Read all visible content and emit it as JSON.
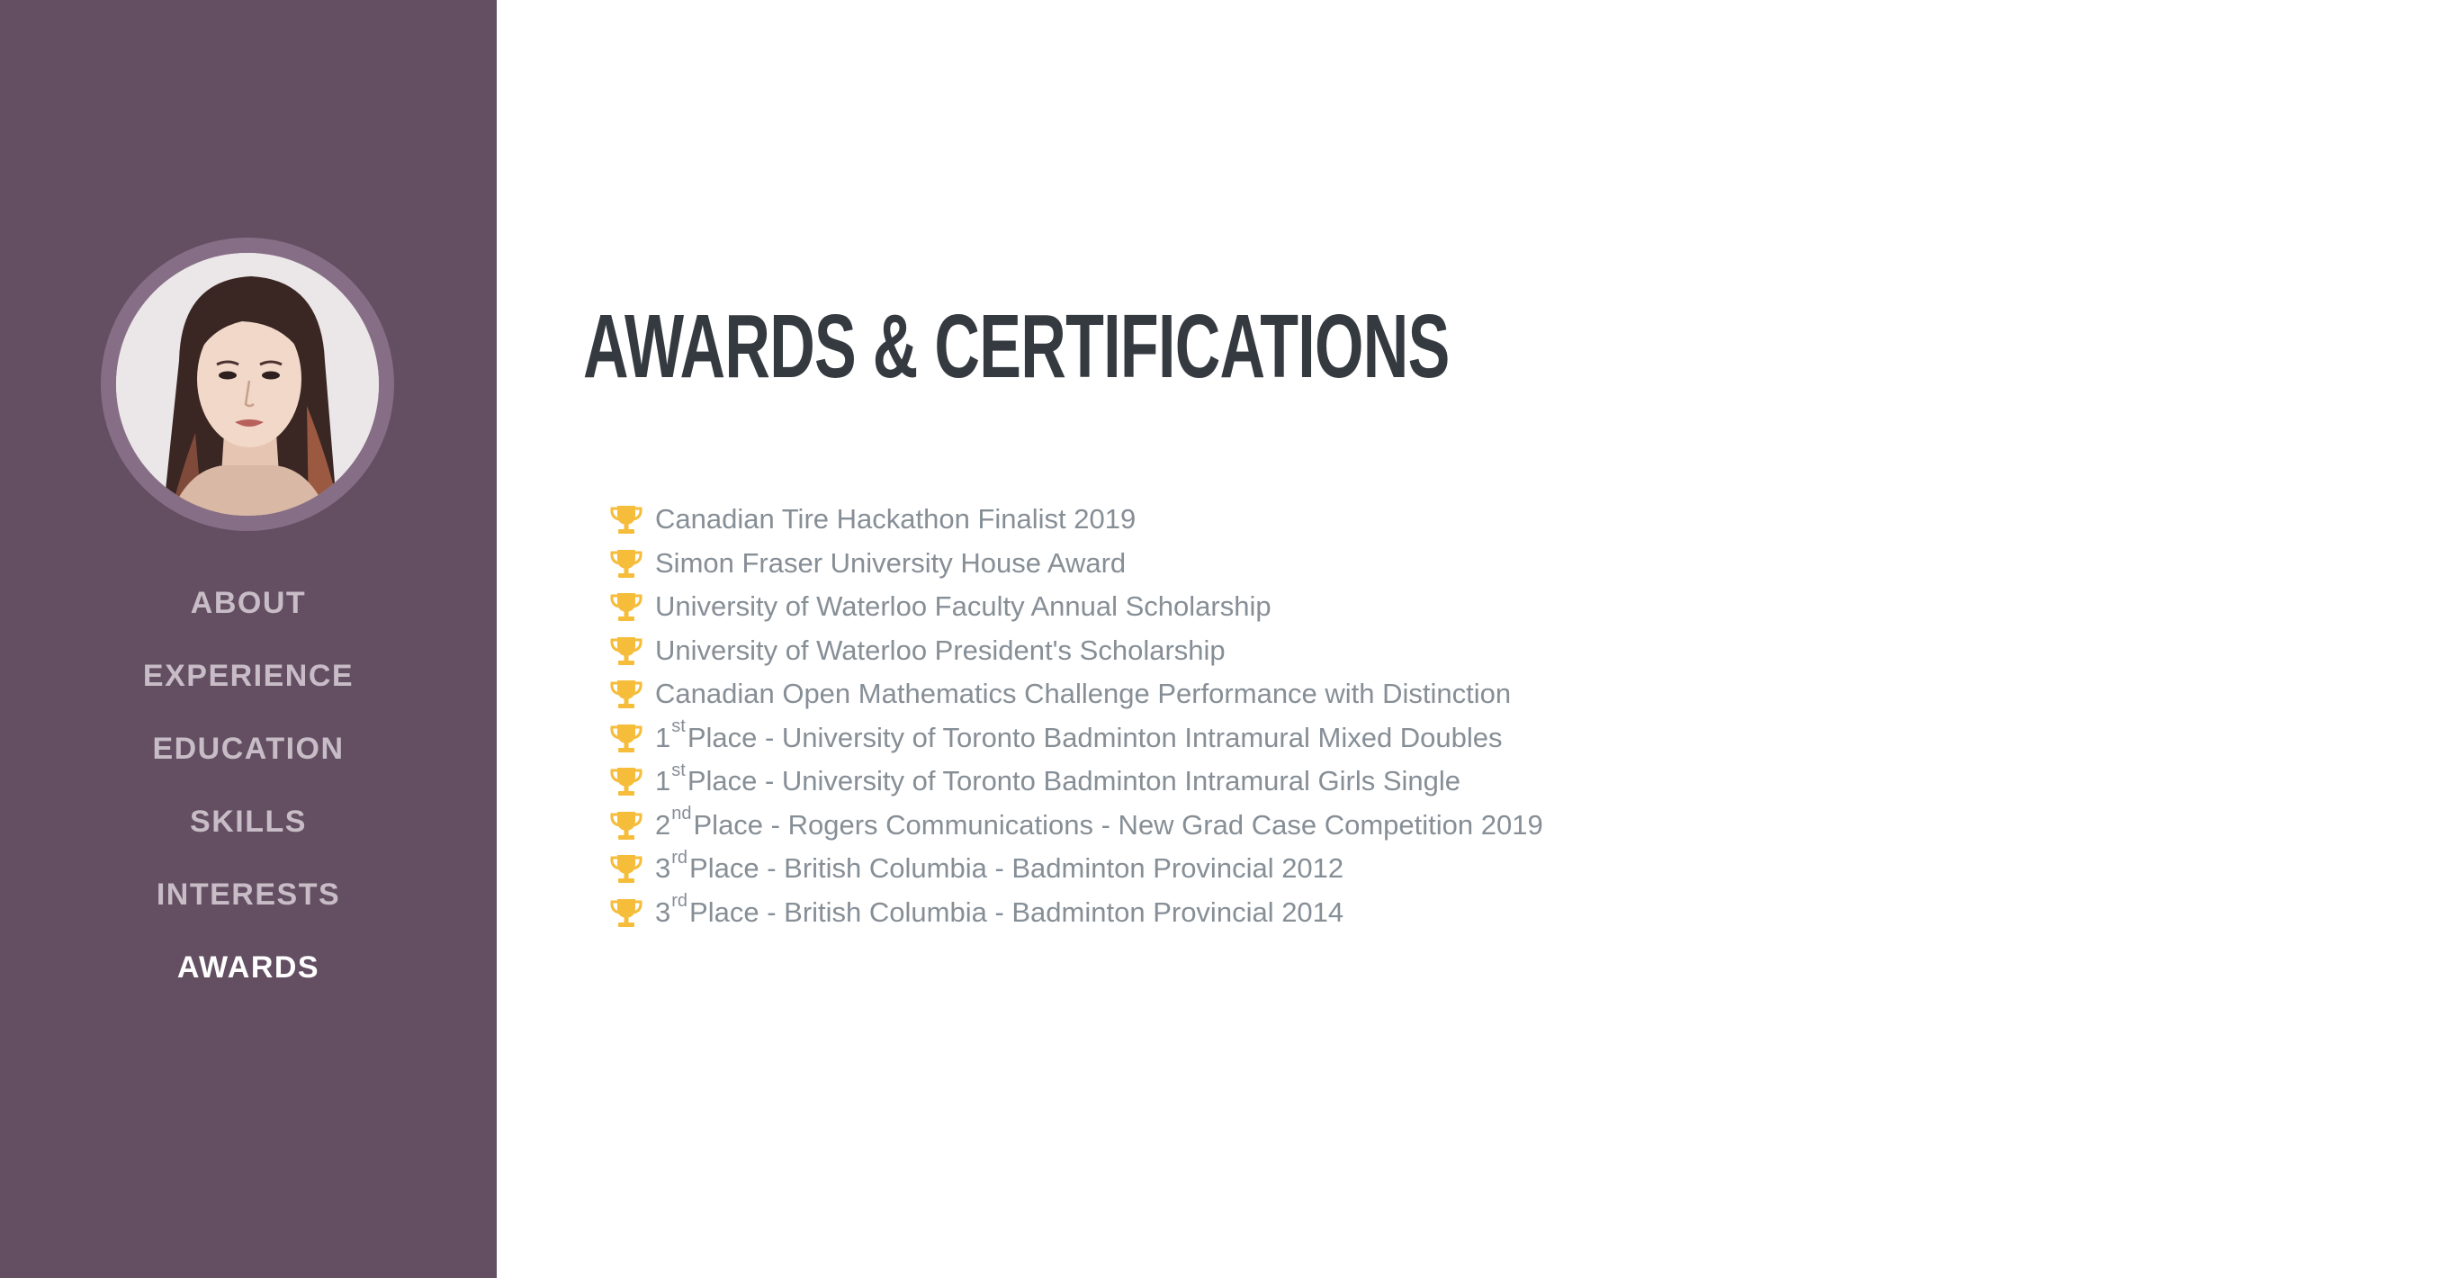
{
  "sidebar": {
    "nav": [
      {
        "label": "ABOUT",
        "active": false
      },
      {
        "label": "EXPERIENCE",
        "active": false
      },
      {
        "label": "EDUCATION",
        "active": false
      },
      {
        "label": "SKILLS",
        "active": false
      },
      {
        "label": "INTERESTS",
        "active": false
      },
      {
        "label": "AWARDS",
        "active": true
      }
    ],
    "background_color": "#634e62",
    "nav_color": "#c8bcc7",
    "nav_active_color": "#ffffff"
  },
  "main": {
    "title": "AWARDS & CERTIFICATIONS",
    "title_color": "#343a40",
    "icon": "trophy-icon",
    "icon_color": "#f6bd3b",
    "awards": [
      {
        "num": "",
        "sup": "",
        "text": "Canadian Tire Hackathon Finalist 2019"
      },
      {
        "num": "",
        "sup": "",
        "text": "Simon Fraser University House Award"
      },
      {
        "num": "",
        "sup": "",
        "text": "University of Waterloo Faculty Annual Scholarship"
      },
      {
        "num": "",
        "sup": "",
        "text": "University of Waterloo President's Scholarship"
      },
      {
        "num": "",
        "sup": "",
        "text": "Canadian Open Mathematics Challenge Performance with Distinction"
      },
      {
        "num": "1",
        "sup": "st",
        "text": "Place - University of Toronto Badminton Intramural Mixed Doubles"
      },
      {
        "num": "1",
        "sup": "st",
        "text": "Place - University of Toronto Badminton Intramural Girls Single"
      },
      {
        "num": "2",
        "sup": "nd",
        "text": "Place - Rogers Communications - New Grad Case Competition 2019"
      },
      {
        "num": "3",
        "sup": "rd",
        "text": "Place - British Columbia - Badminton Provincial 2012"
      },
      {
        "num": "3",
        "sup": "rd",
        "text": "Place - British Columbia - Badminton Provincial 2014"
      }
    ]
  }
}
